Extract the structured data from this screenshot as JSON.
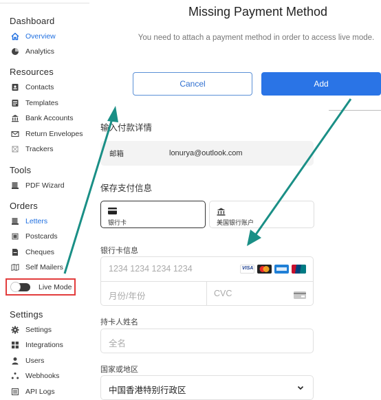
{
  "sidebar": {
    "sections": [
      {
        "title": "Dashboard",
        "items": [
          {
            "label": "Overview",
            "icon": "home-icon",
            "active": true
          },
          {
            "label": "Analytics",
            "icon": "pie-chart-icon"
          }
        ]
      },
      {
        "title": "Resources",
        "items": [
          {
            "label": "Contacts",
            "icon": "contact-card-icon"
          },
          {
            "label": "Templates",
            "icon": "template-icon"
          },
          {
            "label": "Bank Accounts",
            "icon": "bank-icon"
          },
          {
            "label": "Return Envelopes",
            "icon": "envelope-icon"
          },
          {
            "label": "Trackers",
            "icon": "tracker-icon"
          }
        ]
      },
      {
        "title": "Tools",
        "items": [
          {
            "label": "PDF Wizard",
            "icon": "pdf-wizard-icon"
          }
        ]
      },
      {
        "title": "Orders",
        "items": [
          {
            "label": "Letters",
            "icon": "letter-icon"
          },
          {
            "label": "Postcards",
            "icon": "postcard-icon"
          },
          {
            "label": "Cheques",
            "icon": "cheque-icon"
          },
          {
            "label": "Self Mailers",
            "icon": "self-mailer-icon"
          }
        ]
      },
      {
        "title": "Settings",
        "items": [
          {
            "label": "Settings",
            "icon": "gear-icon"
          },
          {
            "label": "Integrations",
            "icon": "integrations-icon"
          },
          {
            "label": "Users",
            "icon": "user-icon"
          },
          {
            "label": "Webhooks",
            "icon": "webhook-icon"
          },
          {
            "label": "API Logs",
            "icon": "api-logs-icon"
          }
        ]
      }
    ],
    "live_mode_label": "Live Mode"
  },
  "modal": {
    "title": "Missing Payment Method",
    "description": "You need to attach a payment method in order to access live mode.",
    "cancel_label": "Cancel",
    "add_label": "Add"
  },
  "payment": {
    "enter_details_heading": "输入付款详情",
    "email_label": "邮箱",
    "email_value": "lonurya@outlook.com",
    "save_payment_heading": "保存支付信息",
    "tabs": [
      {
        "label": "银行卡",
        "icon": "card-icon",
        "selected": true
      },
      {
        "label": "美国银行账户",
        "icon": "bank-icon",
        "selected": false
      }
    ],
    "card_info_label": "银行卡信息",
    "card_number_placeholder": "1234 1234 1234 1234",
    "expiry_placeholder": "月份/年份",
    "cvc_placeholder": "CVC",
    "card_brands": [
      "VISA",
      "mastercard",
      "amex",
      "unionpay"
    ],
    "cardholder_label": "持卡人姓名",
    "fullname_placeholder": "全名",
    "country_label": "国家或地区",
    "country_value": "中国香港特别行政区"
  },
  "colors": {
    "accent": "#2a74e6",
    "highlight_box": "#e23b3b",
    "arrow": "#1a8f86"
  }
}
